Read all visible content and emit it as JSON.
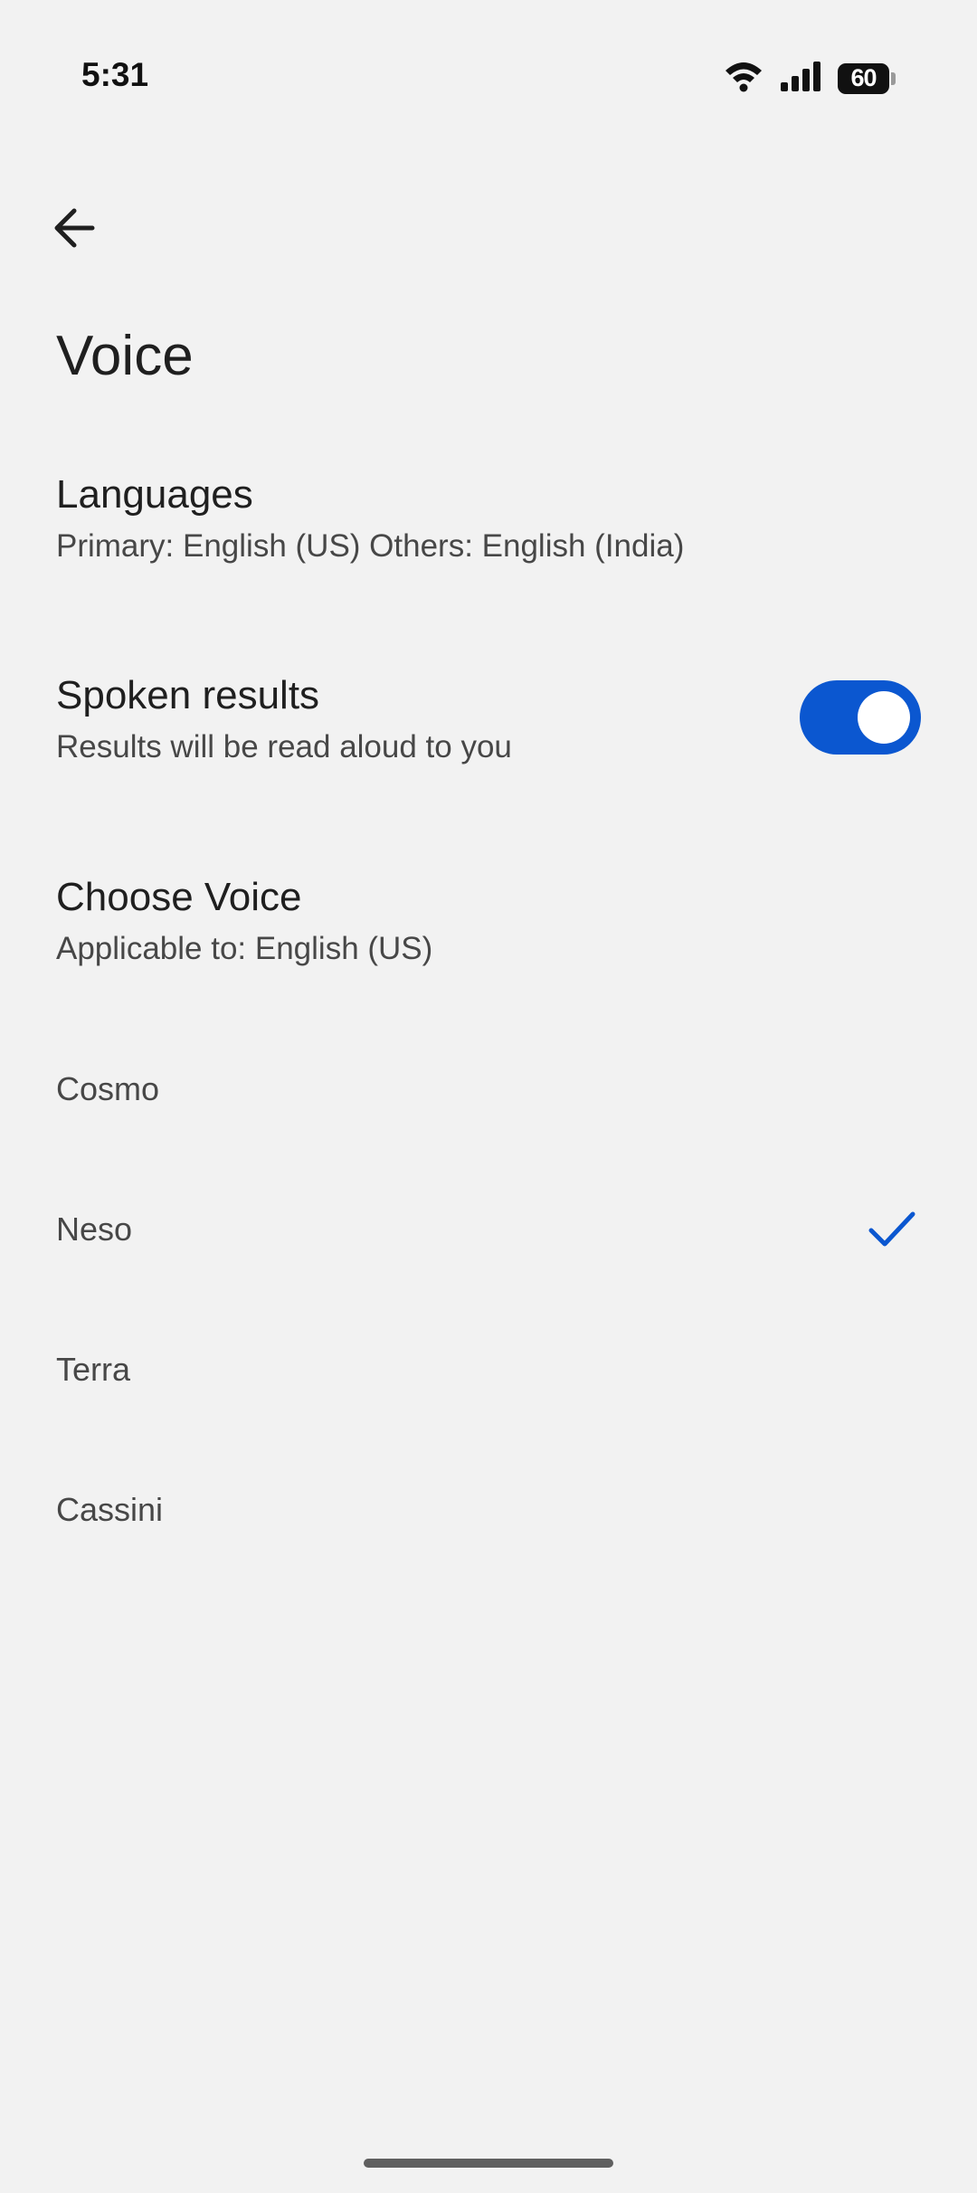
{
  "status_bar": {
    "time": "5:31",
    "battery_level": "60",
    "icons": [
      "wifi-icon",
      "signal-icon",
      "battery-icon"
    ]
  },
  "header": {
    "back_icon": "arrow-back-icon",
    "title": "Voice"
  },
  "settings": {
    "languages": {
      "title": "Languages",
      "subtitle": "Primary: English (US) Others: English (India)"
    },
    "spoken_results": {
      "title": "Spoken results",
      "subtitle": "Results will be read aloud to you",
      "enabled": true
    },
    "choose_voice": {
      "title": "Choose Voice",
      "subtitle": "Applicable to: English (US)"
    }
  },
  "voices": [
    {
      "label": "Cosmo",
      "selected": false
    },
    {
      "label": "Neso",
      "selected": true
    },
    {
      "label": "Terra",
      "selected": false
    },
    {
      "label": "Cassini",
      "selected": false
    }
  ],
  "colors": {
    "accent": "#0b57d0",
    "background": "#f2f2f2"
  }
}
